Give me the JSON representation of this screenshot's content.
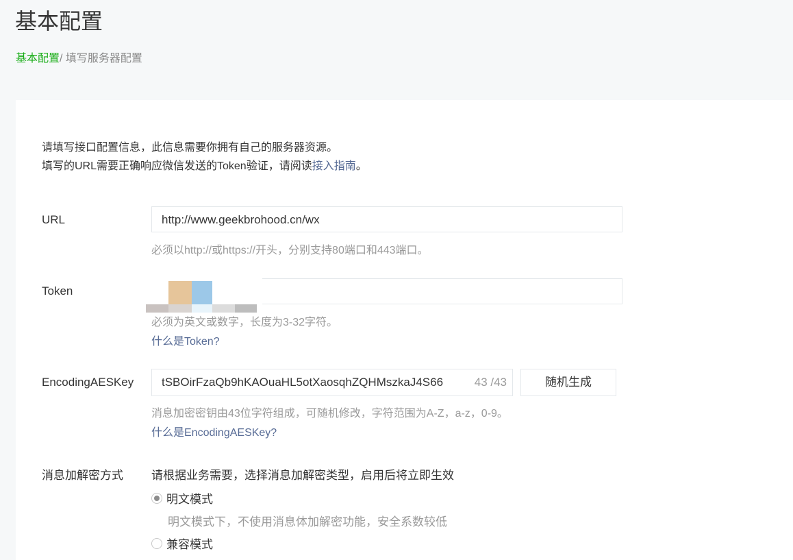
{
  "header": {
    "title": "基本配置",
    "breadcrumb": {
      "root": "基本配置",
      "separator": "/",
      "current": "填写服务器配置"
    }
  },
  "intro": {
    "line1": "请填写接口配置信息，此信息需要你拥有自己的服务器资源。",
    "line2_prefix": "填写的URL需要正确响应微信发送的Token验证，请阅读",
    "line2_link": "接入指南",
    "line2_suffix": "。"
  },
  "url": {
    "label": "URL",
    "value": "http://www.geekbrohood.cn/wx",
    "hint": "必须以http://或https://开头，分别支持80端口和443端口。"
  },
  "token": {
    "label": "Token",
    "hint": "必须为英文或数字，长度为3-32字符。",
    "help_link": "什么是Token?"
  },
  "aes_key": {
    "label": "EncodingAESKey",
    "value": "tSBOirFzaQb9hKAOuaHL5otXaosqhZQHMszkaJ4S66",
    "counter": "43 /43",
    "generate_button": "随机生成",
    "hint": "消息加密密钥由43位字符组成，可随机修改，字符范围为A-Z，a-z，0-9。",
    "help_link": "什么是EncodingAESKey?"
  },
  "encryption": {
    "label": "消息加解密方式",
    "prompt": "请根据业务需要，选择消息加解密类型，启用后将立即生效",
    "options": [
      {
        "label": "明文模式",
        "description": "明文模式下，不使用消息体加解密功能，安全系数较低",
        "checked": true
      },
      {
        "label": "兼容模式",
        "checked": false
      }
    ]
  },
  "colors": {
    "accent_green": "#1aad19",
    "link_blue": "#576b95"
  }
}
